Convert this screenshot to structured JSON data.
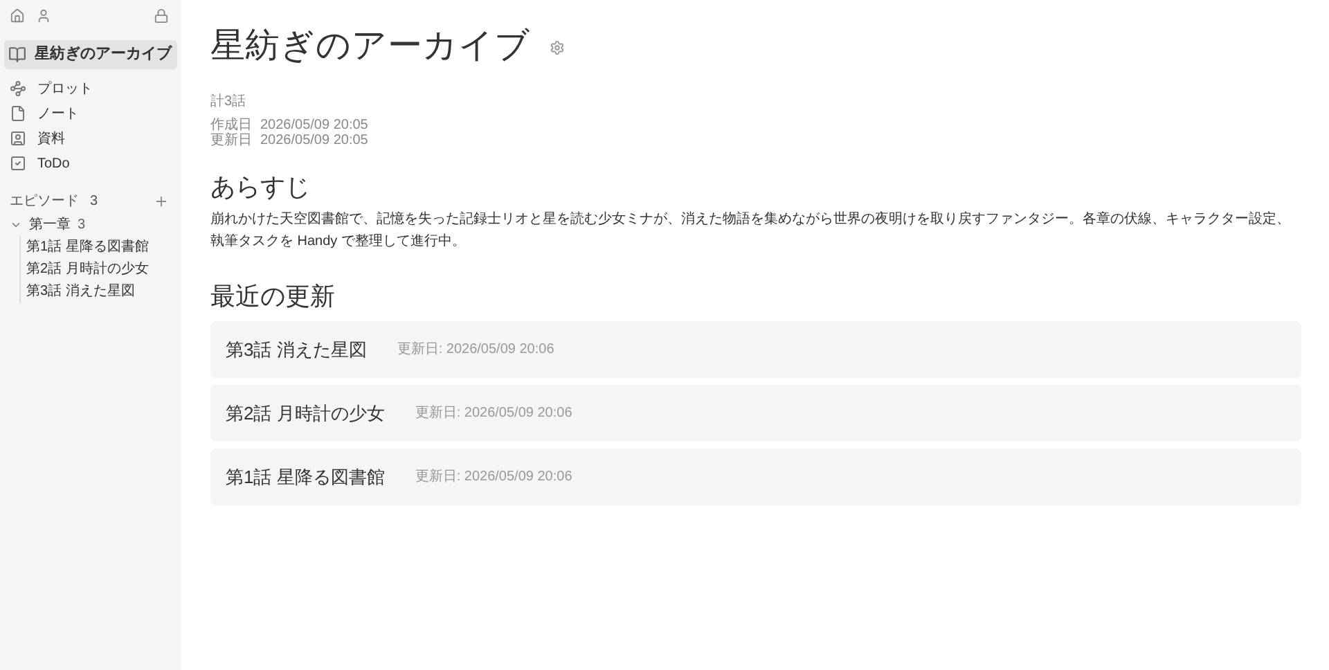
{
  "sidebar": {
    "project": {
      "title": "星紡ぎのアーカイブ",
      "selected": true
    },
    "nav": [
      {
        "kind": "plot",
        "label": "プロット"
      },
      {
        "kind": "note",
        "label": "ノート"
      },
      {
        "kind": "material",
        "label": "資料"
      },
      {
        "kind": "todo",
        "label": "ToDo"
      }
    ],
    "episodes": {
      "label": "エピソード",
      "count": "3",
      "chapters": [
        {
          "title": "第一章",
          "count": "3",
          "expanded": true,
          "children": [
            {
              "label": "第1話 星降る図書館"
            },
            {
              "label": "第2話 月時計の少女"
            },
            {
              "label": "第3話 消えた星図"
            }
          ]
        }
      ]
    }
  },
  "main": {
    "title": "星紡ぎのアーカイブ",
    "total": "計3話",
    "meta": [
      {
        "label": "作成日",
        "value": "2026/05/09 20:05"
      },
      {
        "label": "更新日",
        "value": "2026/05/09 20:05"
      }
    ],
    "synopsis": {
      "heading": "あらすじ",
      "text": "崩れかけた天空図書館で、記憶を失った記録士リオと星を読む少女ミナが、消えた物語を集めながら世界の夜明けを取り戻すファンタジー。各章の伏線、キャラクター設定、執筆タスクを Handy で整理して進行中。"
    },
    "recent": {
      "heading": "最近の更新",
      "items": [
        {
          "title": "第3話 消えた星図",
          "updated": "更新日: 2026/05/09 20:06"
        },
        {
          "title": "第2話 月時計の少女",
          "updated": "更新日: 2026/05/09 20:06"
        },
        {
          "title": "第1話 星降る図書館",
          "updated": "更新日: 2026/05/09 20:06"
        }
      ]
    }
  }
}
